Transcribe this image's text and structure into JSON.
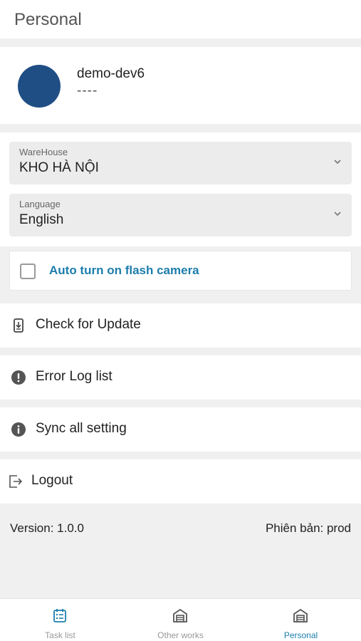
{
  "header": {
    "title": "Personal"
  },
  "profile": {
    "name": "demo-dev6",
    "subtitle": "----",
    "avatar_color": "#1f4e85"
  },
  "warehouse": {
    "label": "WareHouse",
    "value": "KHO HÀ NỘI"
  },
  "language": {
    "label": "Language",
    "value": "English"
  },
  "flash": {
    "label": "Auto turn on flash camera",
    "checked": false,
    "accent": "#1c7dac"
  },
  "menu": {
    "check_update": {
      "label": "Check for Update",
      "icon": "phone-download-icon"
    },
    "error_log": {
      "label": "Error Log list",
      "icon": "exclamation-circle-icon"
    },
    "sync": {
      "label": "Sync all setting",
      "icon": "info-circle-icon"
    },
    "logout": {
      "label": "Logout",
      "icon": "logout-icon"
    }
  },
  "version": {
    "left": "Version: 1.0.0",
    "right": "Phiên bản: prod"
  },
  "nav": {
    "task_list": "Task list",
    "other_works": "Other works",
    "personal": "Personal",
    "active": "personal"
  }
}
